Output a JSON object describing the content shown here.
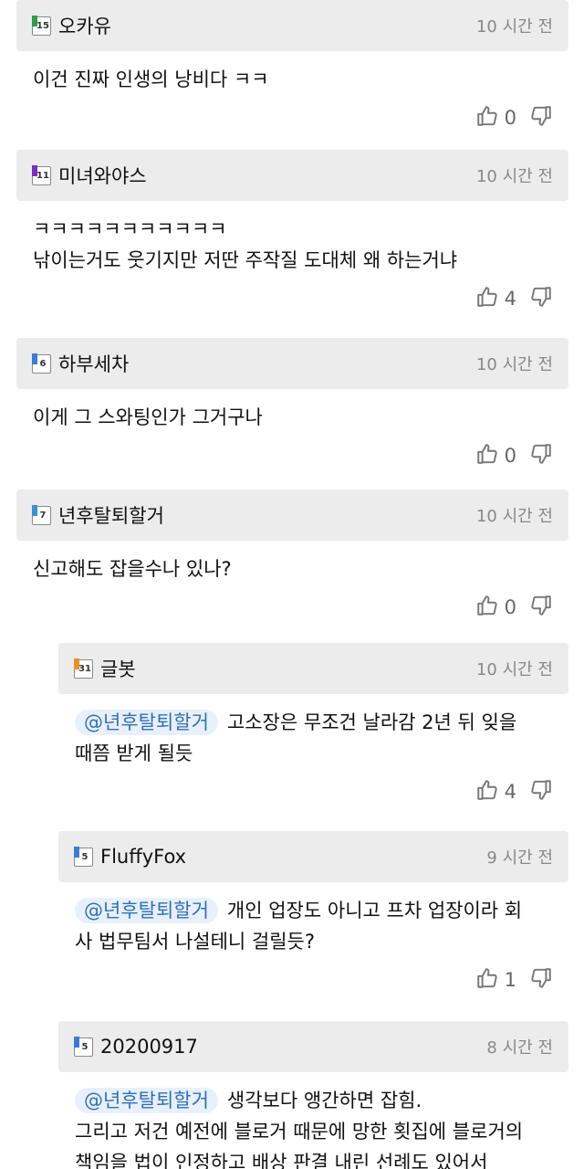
{
  "comments": [
    {
      "rank": "15",
      "badge_color": "#2f9e44",
      "nick": "오카유",
      "time": "10 시간 전",
      "lines": [
        "이건 진짜 인생의 낭비다 ㅋㅋ"
      ],
      "likes": "0"
    },
    {
      "rank": "11",
      "badge_color": "#7b2fbe",
      "nick": "미녀와야스",
      "time": "10 시간 전",
      "lines": [
        "ㅋㅋㅋㅋㅋㅋㅋㅋㅋㅋㅋ",
        "낚이는거도 웃기지만 저딴 주작질 도대체 왜 하는거냐"
      ],
      "likes": "4"
    },
    {
      "rank": "6",
      "badge_color": "#3a7bd5",
      "nick": "하부세차",
      "time": "10 시간 전",
      "lines": [
        "이게 그 스와팅인가 그거구나"
      ],
      "likes": "0"
    },
    {
      "rank": "7",
      "badge_color": "#3a8fd5",
      "nick": "년후탈퇴할거",
      "time": "10 시간 전",
      "lines": [
        "신고해도 잡을수나 있나?"
      ],
      "likes": "0"
    },
    {
      "rank": "31",
      "badge_color": "#e8902a",
      "nick": "글봇",
      "time": "10 시간 전",
      "mention": "@년후탈퇴할거",
      "lines": [
        "고소장은 무조건 날라감 2년 뒤 잊을",
        "때쯤 받게 될듯"
      ],
      "likes": "4"
    },
    {
      "rank": "5",
      "badge_color": "#3a7bd5",
      "nick": "FluffyFox",
      "time": "9 시간 전",
      "mention": "@년후탈퇴할거",
      "lines": [
        "개인 업장도 아니고 프차 업장이라 회",
        "사 법무팀서 나설테니 걸릴듯?"
      ],
      "likes": "1"
    },
    {
      "rank": "5",
      "badge_color": "#3a7bd5",
      "nick": "20200917",
      "time": "8 시간 전",
      "mention": "@년후탈퇴할거",
      "lines": [
        "생각보다 앵간하면 잡힘.",
        "그리고 저건 예전에 블로거 때문에 망한 횟집에 블로거의",
        "책임을 법이 인정하고 배상 판결 내린 선례도 있어서"
      ],
      "likes": ""
    }
  ]
}
